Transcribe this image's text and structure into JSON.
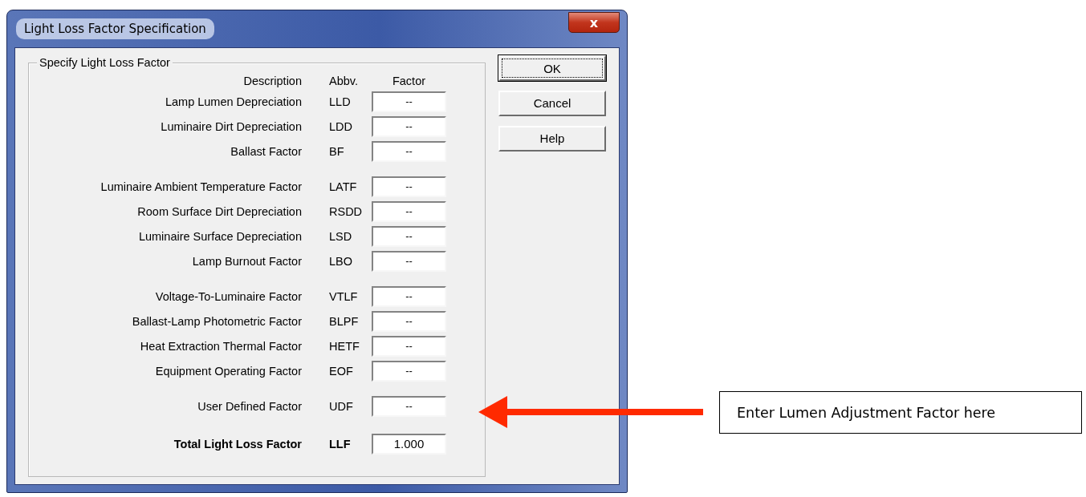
{
  "window": {
    "title": "Light Loss Factor Specification",
    "close_label": "x"
  },
  "group_box": {
    "title": "Specify Light Loss Factor",
    "headers": {
      "description": "Description",
      "abbreviation": "Abbv.",
      "factor": "Factor"
    },
    "groups": [
      {
        "rows": [
          {
            "description": "Lamp Lumen Depreciation",
            "abbreviation": "LLD",
            "value": "--"
          },
          {
            "description": "Luminaire Dirt Depreciation",
            "abbreviation": "LDD",
            "value": "--"
          },
          {
            "description": "Ballast Factor",
            "abbreviation": "BF",
            "value": "--"
          }
        ]
      },
      {
        "rows": [
          {
            "description": "Luminaire Ambient Temperature Factor",
            "abbreviation": "LATF",
            "value": "--"
          },
          {
            "description": "Room Surface Dirt Depreciation",
            "abbreviation": "RSDD",
            "value": "--"
          },
          {
            "description": "Luminaire Surface Depreciation",
            "abbreviation": "LSD",
            "value": "--"
          },
          {
            "description": "Lamp Burnout Factor",
            "abbreviation": "LBO",
            "value": "--"
          }
        ]
      },
      {
        "rows": [
          {
            "description": "Voltage-To-Luminaire Factor",
            "abbreviation": "VTLF",
            "value": "--"
          },
          {
            "description": "Ballast-Lamp Photometric Factor",
            "abbreviation": "BLPF",
            "value": "--"
          },
          {
            "description": "Heat Extraction Thermal Factor",
            "abbreviation": "HETF",
            "value": "--"
          },
          {
            "description": "Equipment Operating Factor",
            "abbreviation": "EOF",
            "value": "--"
          }
        ]
      },
      {
        "rows": [
          {
            "description": "User Defined Factor",
            "abbreviation": "UDF",
            "value": "--"
          }
        ]
      }
    ],
    "total": {
      "description": "Total Light Loss Factor",
      "abbreviation": "LLF",
      "value": "1.000"
    }
  },
  "buttons": [
    {
      "label": "OK",
      "focused": true
    },
    {
      "label": "Cancel",
      "focused": false
    },
    {
      "label": "Help",
      "focused": false
    }
  ],
  "callout": {
    "text": "Enter Lumen Adjustment Factor here"
  }
}
